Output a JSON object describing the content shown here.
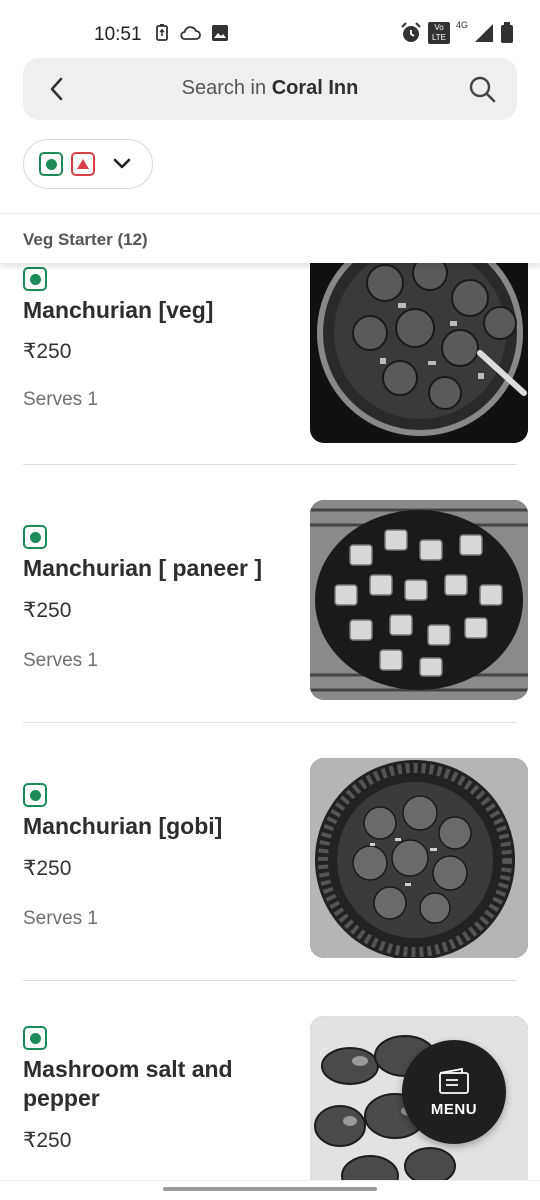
{
  "status_bar": {
    "time": "10:51",
    "network_label": "4G",
    "volte_label": "Vo LTE",
    "icons": [
      "battery-saver-icon",
      "cloud-icon",
      "image-icon",
      "alarm-icon",
      "volte-icon",
      "signal-icon",
      "battery-icon"
    ]
  },
  "search": {
    "prefix": "Search in ",
    "restaurant": "Coral Inn"
  },
  "filter": {
    "veg_icon": "veg-mark-icon",
    "nonveg_icon": "nonveg-mark-icon"
  },
  "section": {
    "title": "Veg Starter (12)"
  },
  "items": [
    {
      "name": "Manchurian [veg]",
      "price": "₹250",
      "serves": "Serves 1"
    },
    {
      "name": "Manchurian [ paneer ]",
      "price": "₹250",
      "serves": "Serves 1"
    },
    {
      "name": "Manchurian [gobi]",
      "price": "₹250",
      "serves": "Serves 1"
    },
    {
      "name": "Mashroom salt and pepper",
      "price": "₹250",
      "serves": ""
    }
  ],
  "fab": {
    "label": "MENU"
  },
  "colors": {
    "veg_green": "#1d8a5a",
    "nonveg_red": "#d94148",
    "fab_bg": "#1f1f1f"
  }
}
